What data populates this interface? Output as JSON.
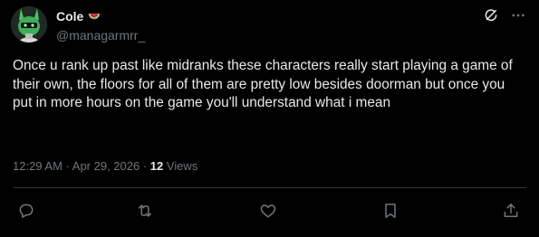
{
  "author": {
    "display_name": "Cole",
    "handle": "@managarmrr_",
    "name_emoji": "watermelon-icon"
  },
  "post": {
    "text": "Once u rank up past like midranks these characters really start playing a game of their own, the floors for all of them are pretty low besides doorman but once you put in more hours on the game you'll understand what i mean",
    "time": "12:29 AM",
    "sep1": " · ",
    "date": "Apr 29, 2026",
    "sep2": " · ",
    "views_count": "12",
    "views_label": " Views"
  },
  "icons": {
    "grok": "grok-icon",
    "more": "more-icon",
    "reply": "reply-icon",
    "repost": "repost-icon",
    "like": "heart-icon",
    "bookmark": "bookmark-icon",
    "share": "share-icon"
  },
  "colors": {
    "background": "#000000",
    "text": "#e7e9ea",
    "muted": "#71767b",
    "divider": "#2f3336",
    "avatar_green": "#3fae5a"
  }
}
